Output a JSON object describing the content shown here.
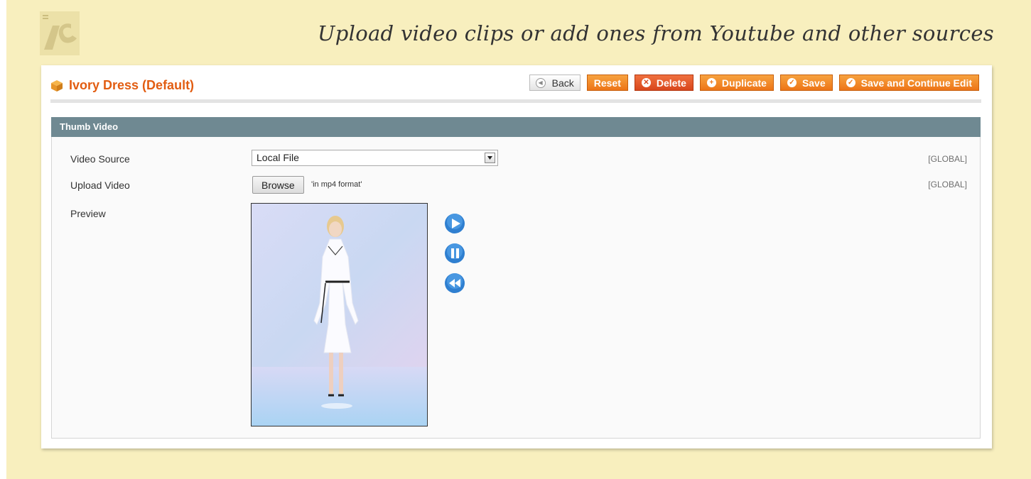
{
  "tagline": "Upload video clips or add ones from Youtube and other sources",
  "header": {
    "title": "Ivory Dress (Default)",
    "buttons": {
      "back": "Back",
      "reset": "Reset",
      "delete": "Delete",
      "duplicate": "Duplicate",
      "save": "Save",
      "save_continue": "Save and Continue Edit"
    }
  },
  "section": {
    "title": "Thumb Video",
    "fields": {
      "video_source": {
        "label": "Video Source",
        "value": "Local File",
        "scope": "[GLOBAL]"
      },
      "upload_video": {
        "label": "Upload Video",
        "button": "Browse",
        "note": "'in mp4 format'",
        "scope": "[GLOBAL]"
      },
      "preview": {
        "label": "Preview"
      }
    }
  },
  "colors": {
    "background": "#f8efbe",
    "accent": "#ed7517",
    "delete": "#d8461c",
    "section_header": "#6f8992",
    "title": "#e25d12"
  },
  "icons": [
    "logo-icon",
    "box-icon",
    "back-icon",
    "delete-icon",
    "duplicate-icon",
    "save-icon",
    "dropdown-arrow-icon",
    "play-icon",
    "pause-icon",
    "rewind-icon"
  ]
}
